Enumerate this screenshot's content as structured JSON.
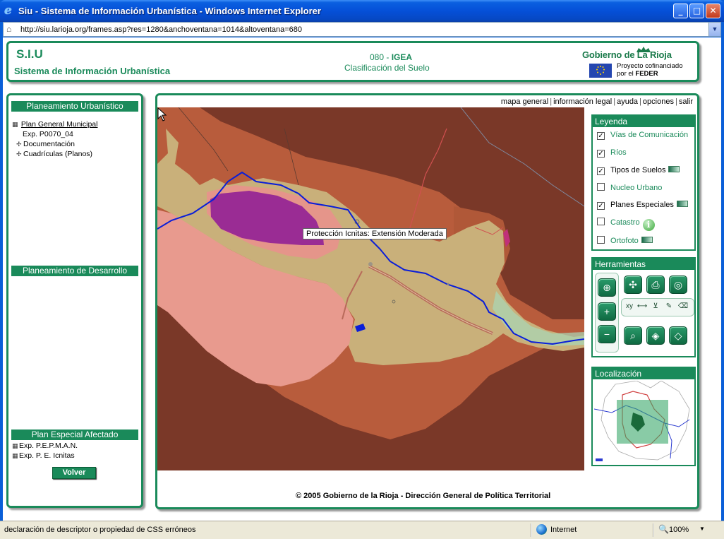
{
  "window": {
    "title": "Siu - Sistema de Información Urbanística - Windows Internet Explorer",
    "url": "http://siu.larioja.org/frames.asp?res=1280&anchoventana=1014&altoventana=680",
    "min_glyph": "_",
    "max_glyph": "□",
    "close_glyph": "✕"
  },
  "status": {
    "text": "declaración de descriptor o propiedad de CSS erróneos",
    "zone": "Internet",
    "zoom": "100%"
  },
  "header": {
    "code": "S.I.U",
    "name": "Sistema de Información Urbanística",
    "map_number": "080",
    "map_dash": " - ",
    "map_entity": "IGEA",
    "map_subtitle": "Clasificación del Suelo",
    "gov_name": "Gobierno de La Rioja",
    "cofinance_line1": "Proyecto cofinanciado",
    "cofinance_prefix": "por el ",
    "cofinance_fund": "FEDER"
  },
  "left": {
    "planeamiento_urbanistico": {
      "title": "Planeamiento Urbanístico",
      "root": "Plan General Municipal",
      "exp": "Exp. P0070_04",
      "items": [
        "Documentación",
        "Cuadrículas (Planos)"
      ]
    },
    "planeamiento_desarrollo": {
      "title": "Planeamiento de Desarrollo"
    },
    "plan_especial": {
      "title": "Plan Especial Afectado",
      "items": [
        "Exp. P.E.P.M.A.N.",
        "Exp. P. E. Icnitas"
      ]
    },
    "volver": "Volver"
  },
  "toplinks": [
    "mapa general",
    "información legal",
    "ayuda",
    "opciones",
    "salir"
  ],
  "toplinks_sep": "|",
  "map": {
    "tooltip": "Protección Icnitas: Extensión Moderada",
    "copyright": "© 2005 Gobierno de la Rioja - Dirección General de Política Territorial",
    "colors": {
      "background": "#7a3828",
      "terrain": "#b85c3c",
      "urban_beige": "#c9b07a",
      "light_pink": "#e89a8e",
      "purple": "#9a2c94",
      "river": "#0a1ed8",
      "road": "#b86a5a"
    }
  },
  "legend": {
    "title": "Leyenda",
    "items": [
      {
        "label": "Vías de Comunicación",
        "checked": true
      },
      {
        "label": "Ríos",
        "checked": true
      },
      {
        "label": "Tipos de Suelos",
        "checked": true
      },
      {
        "label": "Nucleo Urbano",
        "checked": false
      },
      {
        "label": "Planes Especiales",
        "checked": true
      },
      {
        "label": "Catastro",
        "checked": false
      },
      {
        "label": "Ortofoto",
        "checked": false
      }
    ],
    "check_glyph": "✓"
  },
  "tools": {
    "title": "Herramientas"
  },
  "localizacion": {
    "title": "Localización"
  }
}
